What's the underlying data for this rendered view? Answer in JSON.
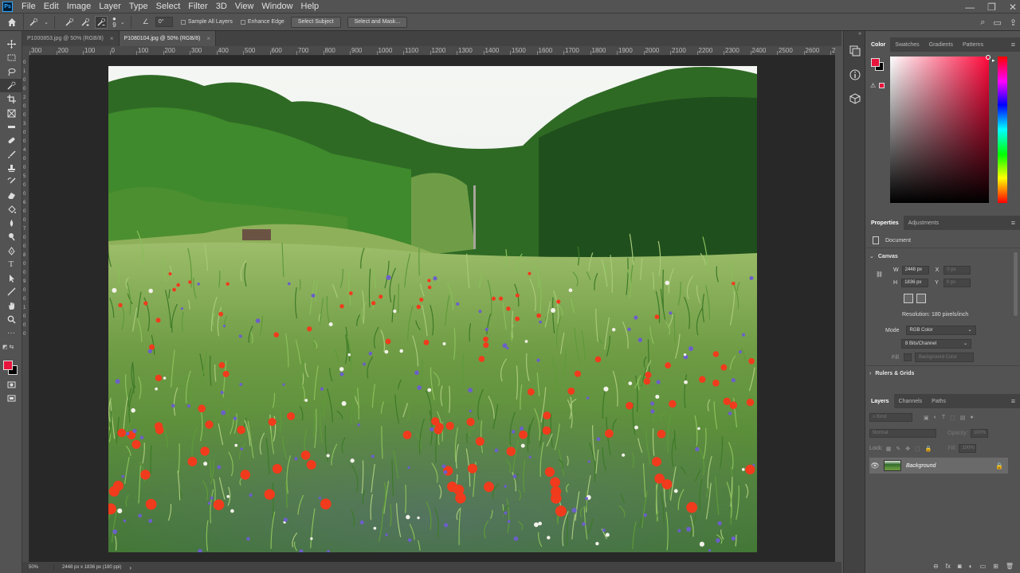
{
  "menubar": {
    "items": [
      "File",
      "Edit",
      "Image",
      "Layer",
      "Type",
      "Select",
      "Filter",
      "3D",
      "View",
      "Window",
      "Help"
    ],
    "window_controls": [
      "—",
      "❐",
      "✕"
    ]
  },
  "options": {
    "brush_size": "9",
    "angle": "0°",
    "sample_all_layers": "Sample All Layers",
    "enhance_edge": "Enhance Edge",
    "select_subject": "Select Subject",
    "select_and_mask": "Select and Mask..."
  },
  "tabs": [
    {
      "label": "P1000853.jpg @ 50% (RGB/8)",
      "close": "×"
    },
    {
      "label": "P1080104.jpg @ 50% (RGB/8)",
      "close": "×"
    }
  ],
  "ruler_h": [
    "300",
    "200",
    "100",
    "0",
    "100",
    "200",
    "300",
    "400",
    "500",
    "600",
    "700",
    "800",
    "900",
    "1000",
    "1100",
    "1200",
    "1300",
    "1400",
    "1500",
    "1600",
    "1700",
    "1800",
    "1900",
    "2000",
    "2100",
    "2200",
    "2300",
    "2400",
    "2500",
    "2600",
    "2700"
  ],
  "ruler_v": [
    "0",
    "1",
    "0",
    "0",
    "2",
    "0",
    "0",
    "3",
    "0",
    "0",
    "4",
    "0",
    "0",
    "5",
    "0",
    "0",
    "6",
    "0",
    "0",
    "7",
    "0",
    "0",
    "8",
    "0",
    "0",
    "9",
    "0",
    "0",
    "1",
    "0",
    "0",
    "0"
  ],
  "status": {
    "zoom": "50%",
    "info": "2448 px x 1836 px (180 ppi)",
    "arrow": "›"
  },
  "color_panel": {
    "tabs": [
      "Color",
      "Swatches",
      "Gradients",
      "Patterns"
    ],
    "fg_color": "#e8143c",
    "bg_color": "#000000"
  },
  "properties": {
    "tabs": [
      "Properties",
      "Adjustments"
    ],
    "document_label": "Document",
    "canvas_header": "Canvas",
    "w_label": "W",
    "w_value": "2448 px",
    "h_label": "H",
    "h_value": "1836 px",
    "x_label": "X",
    "x_value": "0 px",
    "y_label": "Y",
    "y_value": "0 px",
    "resolution": "Resolution: 180 pixels/inch",
    "mode_label": "Mode",
    "mode_value": "RGB Color",
    "bits_value": "8 Bits/Channel",
    "fill_label": "Fill",
    "fill_value": "Background Color",
    "rulers_grids": "Rulers & Grids"
  },
  "layers": {
    "tabs": [
      "Layers",
      "Channels",
      "Paths"
    ],
    "kind_placeholder": "Kind",
    "blend_mode": "Normal",
    "opacity_label": "Opacity:",
    "opacity_value": "100%",
    "lock_label": "Lock:",
    "fill_label": "Fill:",
    "fill_value": "100%",
    "layer_name": "Background"
  }
}
